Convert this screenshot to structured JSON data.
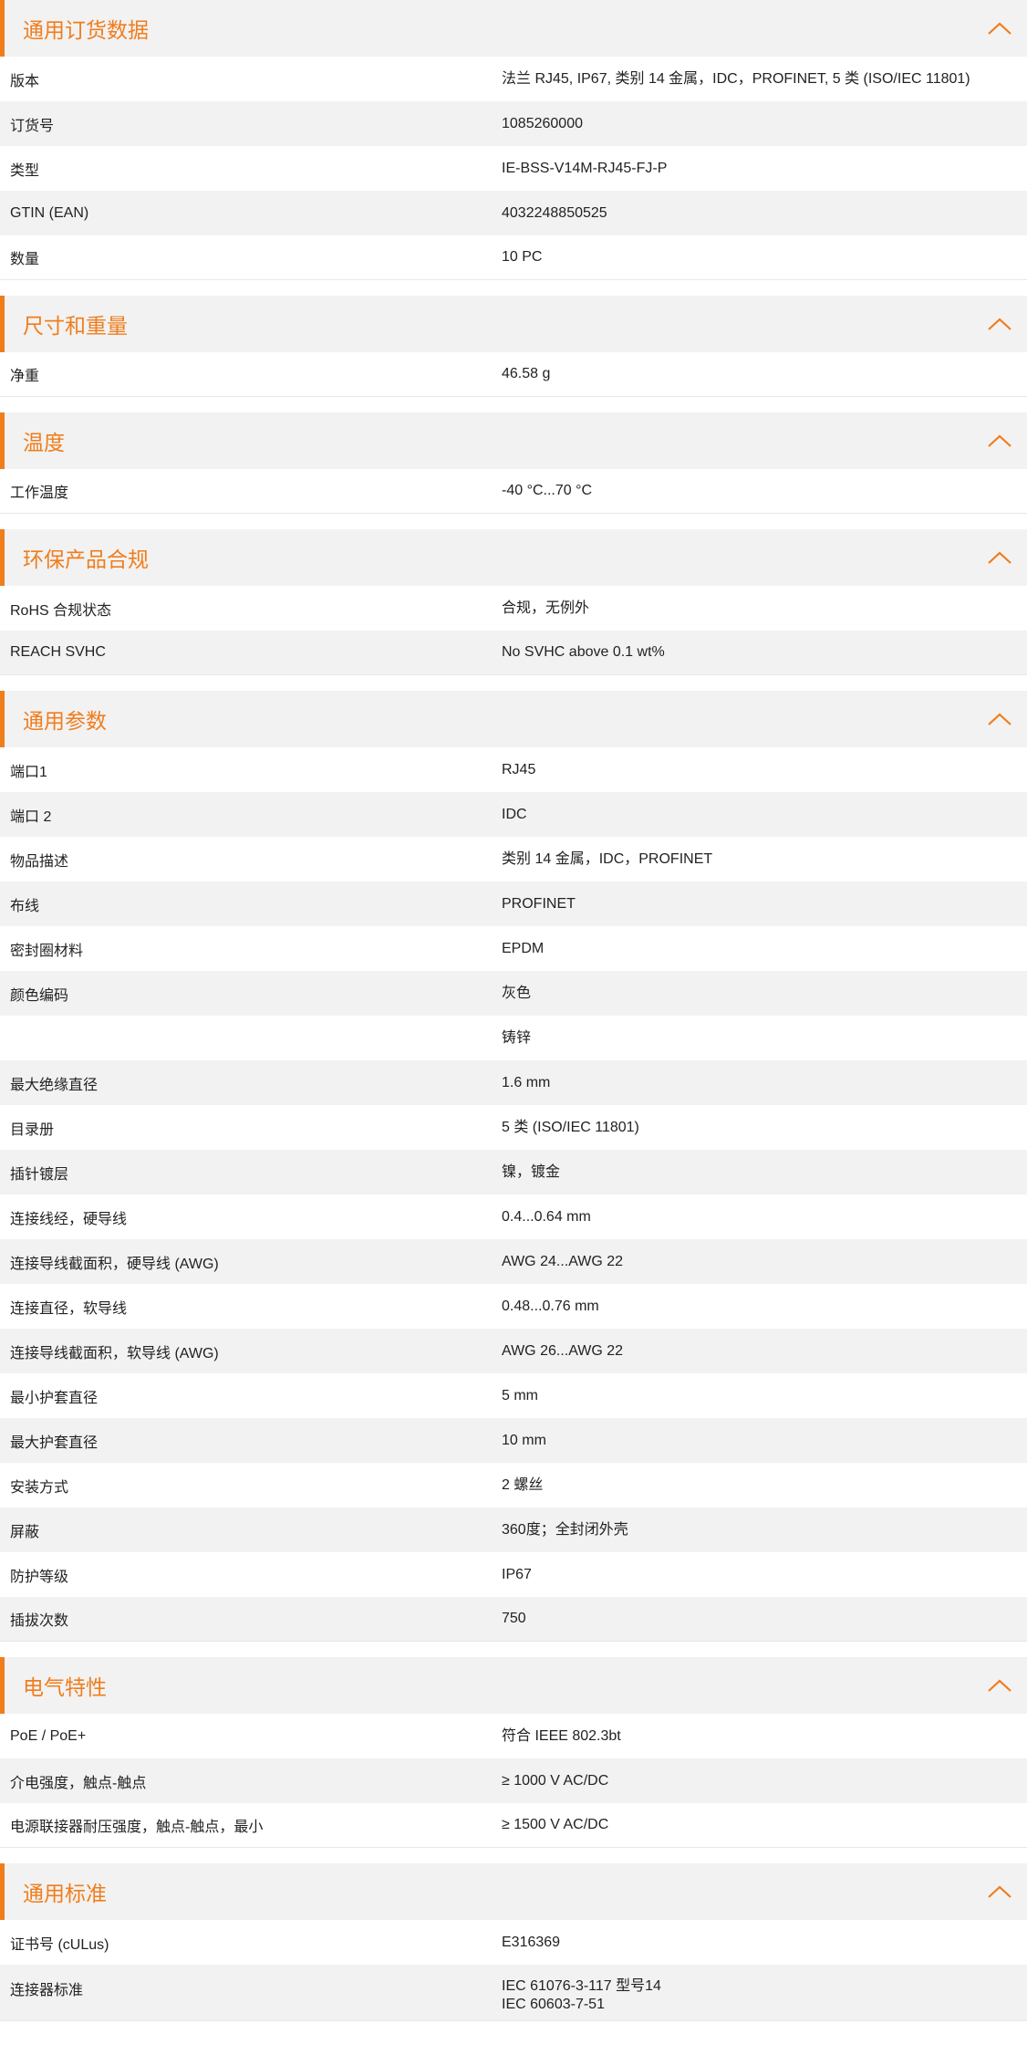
{
  "sections": [
    {
      "title": "通用订货数据",
      "rows": [
        {
          "label": "版本",
          "value": "法兰 RJ45, IP67, 类别 14 金属，IDC，PROFINET, 5 类 (ISO/IEC 11801)"
        },
        {
          "label": "订货号",
          "value": "1085260000"
        },
        {
          "label": "类型",
          "value": "IE-BSS-V14M-RJ45-FJ-P"
        },
        {
          "label": "GTIN (EAN)",
          "value": "4032248850525"
        },
        {
          "label": "数量",
          "value": "10  PC"
        }
      ]
    },
    {
      "title": "尺寸和重量",
      "rows": [
        {
          "label": "净重",
          "value": "46.58  g"
        }
      ]
    },
    {
      "title": "温度",
      "rows": [
        {
          "label": "工作温度",
          "value": "-40 °C...70 °C"
        }
      ]
    },
    {
      "title": "环保产品合规",
      "rows": [
        {
          "label": "RoHS 合规状态",
          "value": "合规，无例外"
        },
        {
          "label": "REACH SVHC",
          "value": "No SVHC above 0.1 wt%"
        }
      ]
    },
    {
      "title": "通用参数",
      "rows": [
        {
          "label": "端口1",
          "value": "RJ45"
        },
        {
          "label": "端口 2",
          "value": "IDC"
        },
        {
          "label": "物品描述",
          "value": "类别 14 金属，IDC，PROFINET"
        },
        {
          "label": "布线",
          "value": "PROFINET"
        },
        {
          "label": "密封圈材料",
          "value": "EPDM"
        },
        {
          "label": "颜色编码",
          "value": "灰色"
        },
        {
          "label": "",
          "value": "铸锌"
        },
        {
          "label": "最大绝缘直径",
          "value": "1.6  mm"
        },
        {
          "label": "目录册",
          "value": "5 类 (ISO/IEC 11801)"
        },
        {
          "label": "插针镀层",
          "value": "镍，镀金"
        },
        {
          "label": "连接线经，硬导线",
          "value": "0.4...0.64 mm"
        },
        {
          "label": "连接导线截面积，硬导线 (AWG)",
          "value": "AWG 24...AWG 22"
        },
        {
          "label": "连接直径，软导线",
          "value": "0.48...0.76 mm"
        },
        {
          "label": "连接导线截面积，软导线 (AWG)",
          "value": "AWG 26...AWG 22"
        },
        {
          "label": "最小护套直径",
          "value": "5  mm"
        },
        {
          "label": "最大护套直径",
          "value": "10  mm"
        },
        {
          "label": "安装方式",
          "value": "2 螺丝"
        },
        {
          "label": "屏蔽",
          "value": "360度；全封闭外壳"
        },
        {
          "label": "防护等级",
          "value": "IP67"
        },
        {
          "label": "插拔次数",
          "value": "750"
        }
      ]
    },
    {
      "title": "电气特性",
      "rows": [
        {
          "label": "PoE / PoE+",
          "value": "符合 IEEE 802.3bt"
        },
        {
          "label": "介电强度，触点-触点",
          "value": "≥ 1000 V AC/DC"
        },
        {
          "label": "电源联接器耐压强度，触点-触点，最小",
          "value": "≥ 1500 V AC/DC"
        }
      ]
    },
    {
      "title": "通用标准",
      "rows": [
        {
          "label": "证书号 (cULus)",
          "value": "E316369"
        },
        {
          "label": "连接器标准",
          "value": "IEC 61076-3-117 型号14\nIEC 60603-7-51"
        }
      ]
    }
  ],
  "icons": {
    "collapse": "chevron-up-icon"
  },
  "colors": {
    "accent": "#f07d1c",
    "stripe": "#f2f2f2"
  }
}
